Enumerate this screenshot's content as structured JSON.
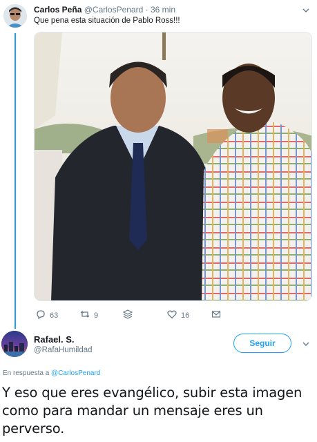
{
  "tweet1": {
    "name": "Carlos Peña",
    "handle": "@CarlosPenard",
    "dot": "·",
    "time": "36 min",
    "text": "Que pena esta situación de Pablo Ross!!!",
    "actions": {
      "reply_count": "63",
      "retweet_count": "9",
      "like_count": "16"
    }
  },
  "tweet2": {
    "name": "Rafael. S.",
    "handle": "@RafaHumildad",
    "follow_label": "Seguir",
    "reply_prefix": "En respuesta a",
    "reply_to": "@CarlosPenard",
    "text": "Y eso que eres evangélico, subir esta imagen como para mandar un mensaje eres un perverso."
  },
  "colors": {
    "accent": "#1da1f2",
    "muted": "#657786",
    "text": "#14171a"
  },
  "icons": [
    "reply-icon",
    "retweet-icon",
    "stack-icon",
    "heart-icon",
    "mail-icon",
    "chevron-down-icon"
  ]
}
